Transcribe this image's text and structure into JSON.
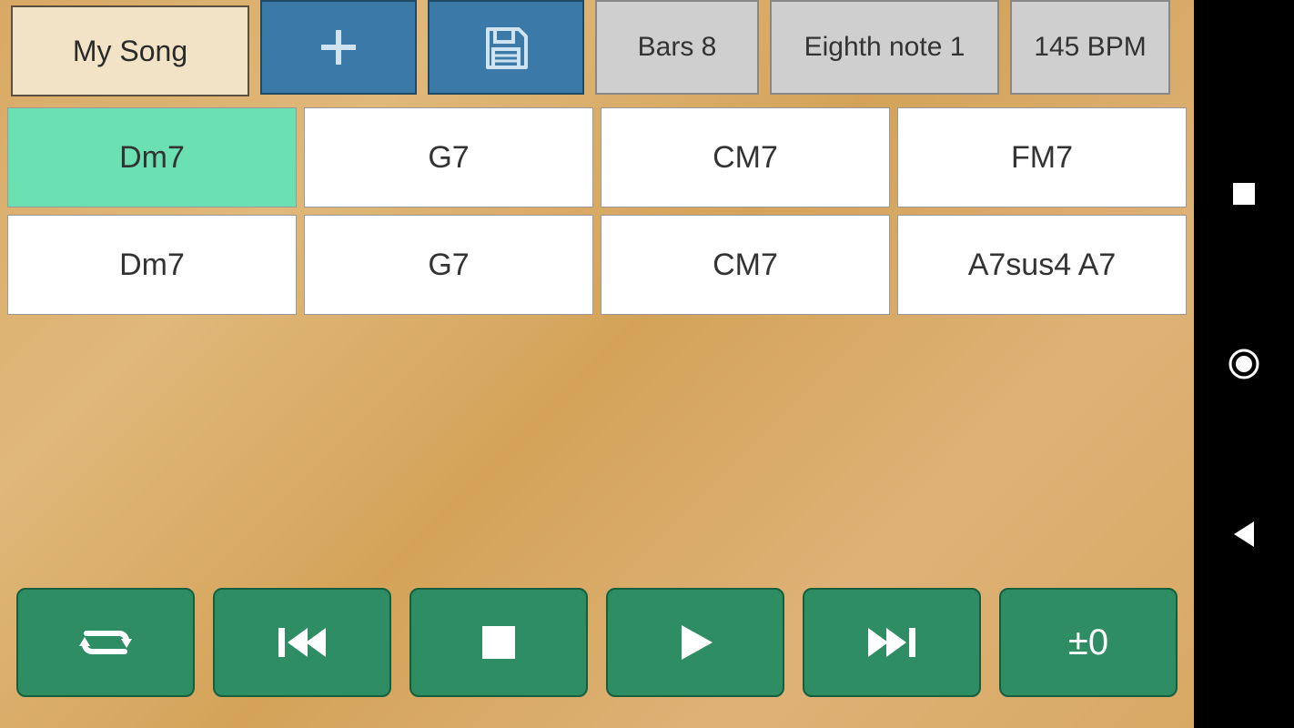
{
  "header": {
    "song_title": "My Song",
    "bars_label": "Bars  8",
    "eighth_label": "Eighth note 1",
    "bpm_label": "145 BPM"
  },
  "chords": {
    "row1": [
      "Dm7",
      "G7",
      "CM7",
      "FM7"
    ],
    "row2": [
      "Dm7",
      "G7",
      "CM7",
      "A7sus4  A7"
    ]
  },
  "active_chord": {
    "row": 0,
    "col": 0
  },
  "transport": {
    "transpose_label": "±0"
  },
  "icons": {
    "add": "plus-icon",
    "save": "save-icon",
    "loop": "loop-icon",
    "prev": "skip-prev-icon",
    "stop": "stop-icon",
    "play": "play-icon",
    "next": "skip-next-icon"
  },
  "colors": {
    "wood_bg": "#d8a964",
    "song_title_bg": "#f2e3c6",
    "blue_btn": "#3b7aa8",
    "grey_btn": "#cfcfcf",
    "chord_active": "#6be0b3",
    "transport_btn": "#2e8d62"
  }
}
